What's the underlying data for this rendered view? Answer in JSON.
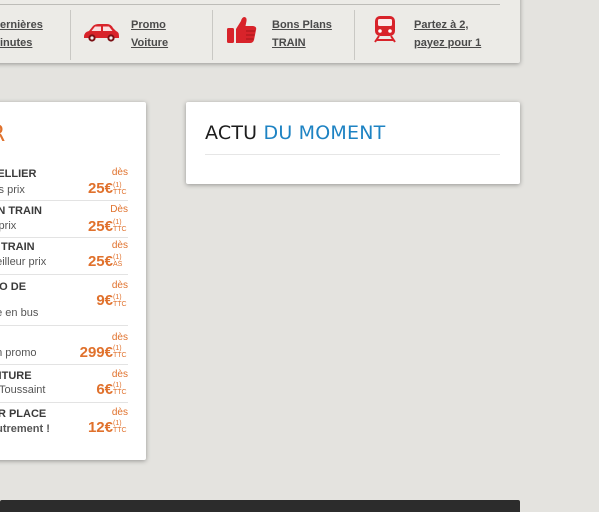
{
  "promo_strip": {
    "items": [
      {
        "line1": "ernières",
        "line2": "inutes",
        "icon": "none"
      },
      {
        "line1": "Promo",
        "line2": "Voiture",
        "icon": "car-icon"
      },
      {
        "line1": "Bons Plans",
        "line2": "TRAIN",
        "icon": "thumbs-up-icon"
      },
      {
        "line1": "Partez à 2,",
        "line2": "payez pour 1",
        "icon": "train-icon"
      }
    ]
  },
  "offers": {
    "title": "R",
    "rows": [
      {
        "name": "PELLIER",
        "sub": "tits prix",
        "des": "dès",
        "price": "25€",
        "sup1": "(1)",
        "sup2": "TTC"
      },
      {
        "name": "EN TRAIN",
        "sub": "s prix",
        "des": "Dès",
        "price": "25€",
        "sup1": "(1)",
        "sup2": "TTC"
      },
      {
        "name": "N TRAIN",
        "sub": "neilleur prix",
        "des": "dès",
        "price": "25€",
        "sup1": "(1)",
        "sup2": "AS"
      },
      {
        "name": "MO DE",
        "sub": "pe en bus",
        "des": "dès",
        "price": "9€",
        "sup1": "(1)",
        "sup2": "TTC"
      },
      {
        "name": "",
        "sub": "en promo",
        "des": "dès",
        "price": "299€",
        "sup1": "(1)",
        "sup2": "TTC"
      },
      {
        "name": "OITURE",
        "sub": "a Toussaint",
        "des": "dès",
        "price": "6€",
        "sup1": "(1)",
        "sup2": "TTC"
      },
      {
        "name": "UR PLACE",
        "sub": "autrement !",
        "des": "dès",
        "price": "12€",
        "sup1": "(1)",
        "sup2": "TTC"
      }
    ]
  },
  "news": {
    "title_part1": "ACTU",
    "title_part2": "DU MOMENT"
  },
  "colors": {
    "accent_orange": "#e0712c",
    "accent_blue": "#1e83c3",
    "icon_red": "#d8232a"
  }
}
